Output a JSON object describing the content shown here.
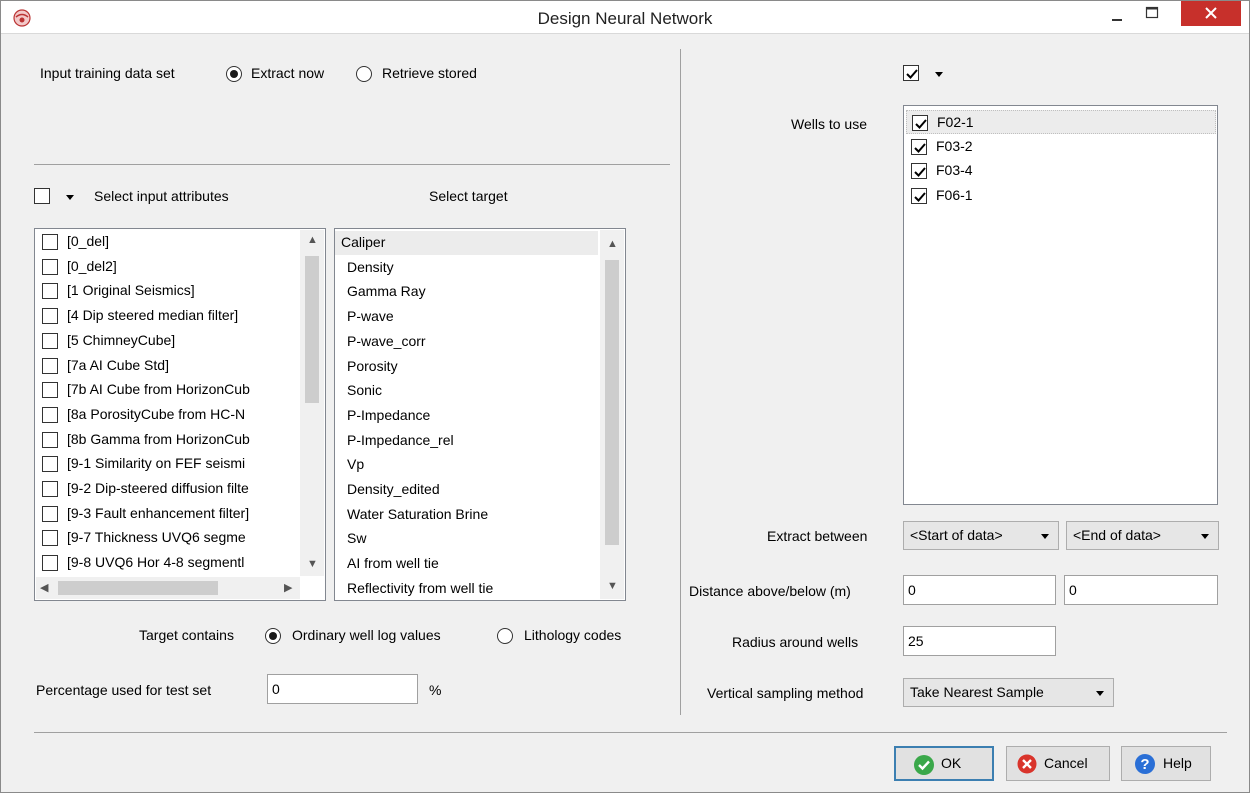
{
  "window": {
    "title": "Design Neural Network"
  },
  "input_dataset": {
    "label": "Input training data set",
    "options": [
      "Extract now",
      "Retrieve stored"
    ],
    "selected": "Extract now"
  },
  "attributes": {
    "header": "Select input attributes",
    "items": [
      "[0_del]",
      "[0_del2]",
      "[1 Original Seismics]",
      "[4 Dip steered median filter]",
      "[5 ChimneyCube]",
      "[7a AI Cube Std]",
      "[7b AI Cube from HorizonCub",
      "[8a PorosityCube from HC-N",
      "[8b Gamma from HorizonCub",
      "[9-1 Similarity on FEF seismi",
      "[9-2 Dip-steered diffusion filte",
      "[9-3 Fault enhancement filter]",
      "[9-7 Thickness UVQ6 segme",
      "[9-8 UVQ6 Hor 4-8 segmentl"
    ]
  },
  "target": {
    "header": "Select target",
    "items": [
      "Caliper",
      "Density",
      "Gamma Ray",
      "P-wave",
      "P-wave_corr",
      "Porosity",
      "Sonic",
      "P-Impedance",
      "P-Impedance_rel",
      "Vp",
      "Density_edited",
      "Water Saturation Brine",
      "Sw",
      "AI from well tie",
      "Reflectivity from well tie"
    ],
    "selected": "Caliper"
  },
  "target_contains": {
    "label": "Target contains",
    "options": [
      "Ordinary well log values",
      "Lithology codes"
    ],
    "selected": "Ordinary well log values"
  },
  "test_set": {
    "label": "Percentage used for test set",
    "value": "0",
    "unit": "%"
  },
  "wells": {
    "label": "Wells to use",
    "items": [
      "F02-1",
      "F03-2",
      "F03-4",
      "F06-1"
    ]
  },
  "extract_between": {
    "label": "Extract between",
    "start": "<Start of data>",
    "end": "<End of data>"
  },
  "distance": {
    "label": "Distance above/below (m)",
    "above": "0",
    "below": "0"
  },
  "radius": {
    "label": "Radius around wells",
    "value": "25"
  },
  "vertical_sampling": {
    "label": "Vertical sampling method",
    "value": "Take Nearest Sample"
  },
  "buttons": {
    "ok": "OK",
    "cancel": "Cancel",
    "help": "Help"
  },
  "colors": {
    "close_red": "#c7302b",
    "ok_green": "#3aa84a",
    "cancel_red": "#d9342b",
    "help_blue": "#2a6fd6"
  }
}
